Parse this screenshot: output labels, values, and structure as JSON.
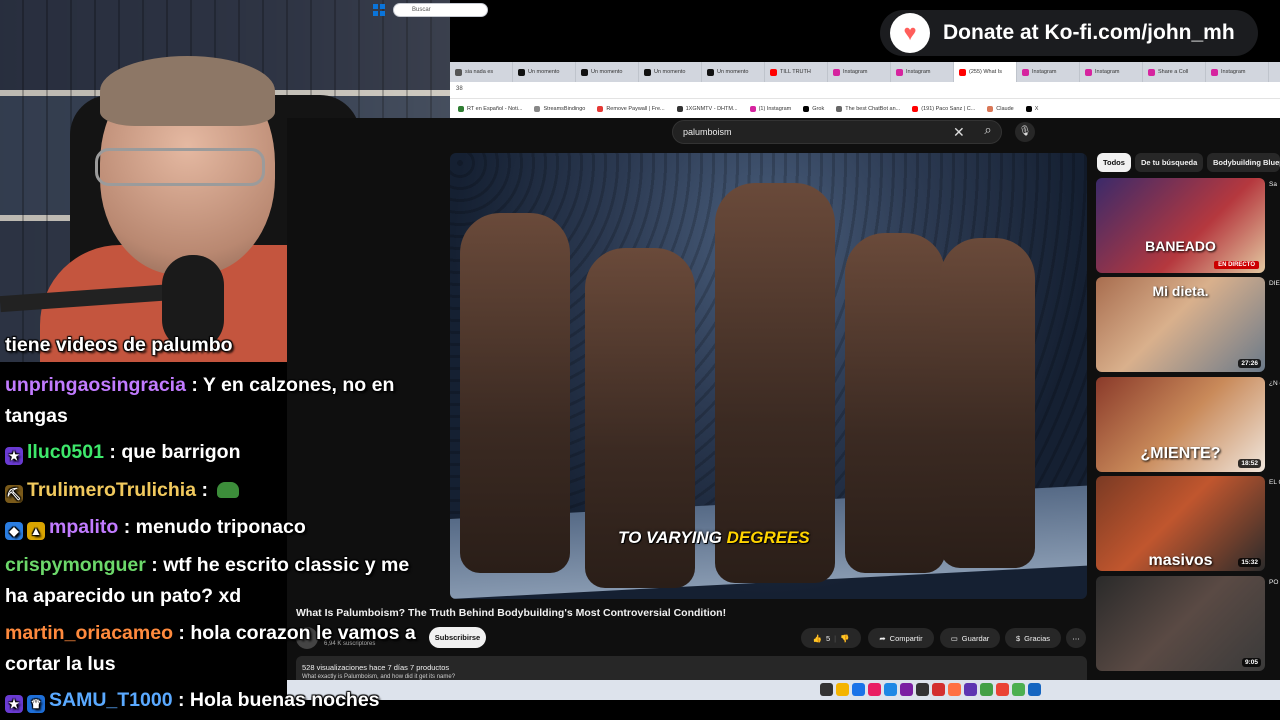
{
  "overlay": {
    "kofi_text": "Donate at Ko-fi.com/john_mh"
  },
  "browser": {
    "tabs": [
      {
        "label": "sia nada es",
        "color": "#555"
      },
      {
        "label": "Un momento",
        "color": "#111"
      },
      {
        "label": "Un momento",
        "color": "#111"
      },
      {
        "label": "Un momento",
        "color": "#111"
      },
      {
        "label": "Un momento",
        "color": "#111"
      },
      {
        "label": "TILL TRUTH",
        "color": "#ff0000"
      },
      {
        "label": "Instagram",
        "color": "#d6249f"
      },
      {
        "label": "Instagram",
        "color": "#d6249f"
      },
      {
        "label": "(255) What Is",
        "color": "#ff0000",
        "active": true
      },
      {
        "label": "Instagram",
        "color": "#d6249f"
      },
      {
        "label": "Instagram",
        "color": "#d6249f"
      },
      {
        "label": "Share a Coll",
        "color": "#d6249f"
      },
      {
        "label": "Instagram",
        "color": "#d6249f"
      }
    ],
    "bookmarks": [
      {
        "label": "RT en Español - Noti...",
        "color": "#2e7d32"
      },
      {
        "label": "StreamsBindingo",
        "color": "#888"
      },
      {
        "label": "Remove Paywall | Fre...",
        "color": "#e53935"
      },
      {
        "label": "1XGNMTV - DHTM...",
        "color": "#333"
      },
      {
        "label": "(1) Instagram",
        "color": "#d6249f"
      },
      {
        "label": "Grok",
        "color": "#000"
      },
      {
        "label": "The best ChatBot an...",
        "color": "#666"
      },
      {
        "label": "(191) Paco Sanz | C...",
        "color": "#ff0000"
      },
      {
        "label": "Claude",
        "color": "#d97757"
      },
      {
        "label": "X",
        "color": "#000"
      }
    ]
  },
  "youtube": {
    "search_query": "palumboism",
    "caption_white": "TO VARYING ",
    "caption_yellow": "DEGREES",
    "video_title": "What Is Palumboism? The Truth Behind Bodybuilding's Most Controversial Condition!",
    "channel_subs": "6,94 K suscriptores",
    "subscribe_label": "Subscribirse",
    "likes": "5",
    "share_label": "Compartir",
    "save_label": "Guardar",
    "thanks_label": "Gracias",
    "desc_meta": "528 visualizaciones  hace 7 días  7 productos",
    "desc_line": "What exactly is Palumboism, and how did it get its name?",
    "chips": [
      "Todos",
      "De tu búsqueda",
      "Bodybuilding Bluep"
    ],
    "recs": [
      {
        "overlay": "BANEADO",
        "badge": "EN DIRECTO",
        "side": "Sa",
        "bg": "linear-gradient(135deg,#3b2a6a,#b5383e 60%,#e3c9a2)"
      },
      {
        "overlay": "Mi dieta.",
        "dur": "27:26",
        "side": "DIE en",
        "bg": "linear-gradient(135deg,#a86d4f,#d9b08c 45%,#6b7a8a)"
      },
      {
        "overlay": "¿MIENTE?",
        "dur": "18:52",
        "side": "¿N de",
        "bg": "linear-gradient(135deg,#8a3a2a,#c98a5a 50%,#f0e6dc)"
      },
      {
        "overlay": "masivos",
        "dur": "15:32",
        "side": "EL CR",
        "bg": "linear-gradient(135deg,#7a3a24,#c0562e 45%,#2b2b2b)"
      },
      {
        "overlay": "",
        "dur": "9:05",
        "side": "PO PE",
        "bg": "linear-gradient(135deg,#2a2a2a,#5a4a44 50%,#3a3a3a)"
      }
    ]
  },
  "taskbar": {
    "search_placeholder": "Buscar"
  },
  "chat": {
    "messages": [
      {
        "user": "",
        "user_color": "#ffffff",
        "text": "tiene videos de palumbo"
      },
      {
        "user": "unpringaosingracia",
        "user_color": "#c17bff",
        "text": " : Y en calzones, no en tangas"
      },
      {
        "user": "lluc0501",
        "user_color": "#3ee86b",
        "text": " : que barrigon"
      },
      {
        "user": "TrulimeroTrulichia",
        "user_color": "#f1c95d",
        "text": " : "
      },
      {
        "user": "mpalito",
        "user_color": "#c17bff",
        "text": " : menudo triponaco"
      },
      {
        "user": "crispymonguer",
        "user_color": "#6cd86a",
        "text": " : wtf he escrito classic y me ha aparecido un pato? xd"
      },
      {
        "user": "martin_oriacameo",
        "user_color": "#ff8a3d",
        "text": " : hola corazon le vamos a cortar la lus"
      },
      {
        "user": "SAMU_T1000",
        "user_color": "#5aa9ff",
        "text": " : Hola buenas noches"
      }
    ]
  }
}
